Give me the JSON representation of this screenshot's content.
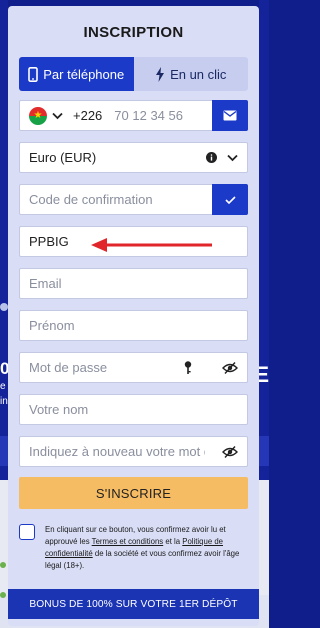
{
  "modal": {
    "title": "INSCRIPTION",
    "tabs": [
      {
        "label": "Par téléphone",
        "icon": "phone-icon",
        "active": true
      },
      {
        "label": "En un clic",
        "icon": "lightning-icon",
        "active": false
      }
    ]
  },
  "phone": {
    "country_code": "+226",
    "placeholder": "70 12 34 56"
  },
  "currency": {
    "value": "Euro (EUR)"
  },
  "confirmation": {
    "placeholder": "Code de confirmation"
  },
  "promo": {
    "value": "PPBIG"
  },
  "email": {
    "placeholder": "Email"
  },
  "first_name": {
    "placeholder": "Prénom"
  },
  "password": {
    "placeholder": "Mot de passe"
  },
  "last_name": {
    "placeholder": "Votre nom"
  },
  "password_repeat": {
    "placeholder": "Indiquez à nouveau votre mot de passe"
  },
  "submit": {
    "label": "S'INSCRIRE"
  },
  "consent": {
    "text_1": "En cliquant sur ce bouton, vous confirmez avoir lu et approuvé les ",
    "terms_link": "Termes et conditions",
    "text_2": " et la ",
    "privacy_link": "Politique de confidentialité",
    "text_3": " de la société et vous confirmez avoir l'âge légal (18+)."
  },
  "bonus": {
    "label": "BONUS DE 100% SUR VOTRE 1ER DÉPÔT"
  },
  "background": {
    "big_digit": "0",
    "letter": "E",
    "small_1": "e",
    "small_2": "in"
  },
  "colors": {
    "accent": "#1c3ac8",
    "modal_bg": "#d9def6",
    "submit_bg": "#f6bc63",
    "arrow": "#e0262a"
  }
}
